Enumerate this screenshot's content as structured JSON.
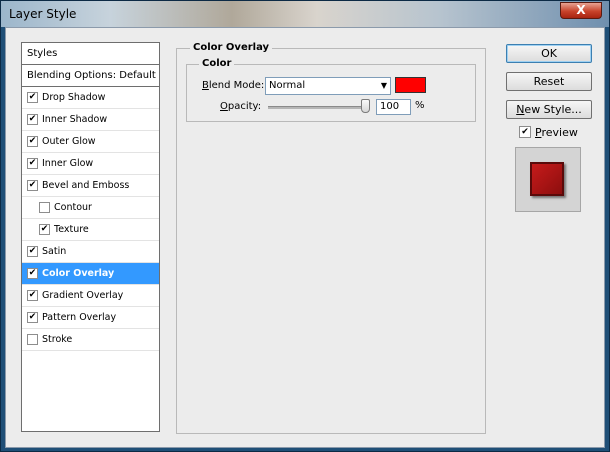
{
  "window": {
    "title": "Layer Style",
    "close_label": "X"
  },
  "styles_panel": {
    "header": "Styles",
    "blending_options": "Blending Options: Default",
    "items": [
      {
        "label": "Drop Shadow",
        "checked": true,
        "indent": false,
        "selected": false
      },
      {
        "label": "Inner Shadow",
        "checked": true,
        "indent": false,
        "selected": false
      },
      {
        "label": "Outer Glow",
        "checked": true,
        "indent": false,
        "selected": false
      },
      {
        "label": "Inner Glow",
        "checked": true,
        "indent": false,
        "selected": false
      },
      {
        "label": "Bevel and Emboss",
        "checked": true,
        "indent": false,
        "selected": false
      },
      {
        "label": "Contour",
        "checked": false,
        "indent": true,
        "selected": false
      },
      {
        "label": "Texture",
        "checked": true,
        "indent": true,
        "selected": false
      },
      {
        "label": "Satin",
        "checked": true,
        "indent": false,
        "selected": false
      },
      {
        "label": "Color Overlay",
        "checked": true,
        "indent": false,
        "selected": true
      },
      {
        "label": "Gradient Overlay",
        "checked": true,
        "indent": false,
        "selected": false
      },
      {
        "label": "Pattern Overlay",
        "checked": true,
        "indent": false,
        "selected": false
      },
      {
        "label": "Stroke",
        "checked": false,
        "indent": false,
        "selected": false
      }
    ]
  },
  "settings": {
    "group_title": "Color Overlay",
    "sub_group_title": "Color",
    "blend_mode_label_u": "B",
    "blend_mode_label_rest": "lend Mode:",
    "blend_mode_value": "Normal",
    "overlay_color": "#ff0000",
    "opacity_label_u": "O",
    "opacity_label_rest": "pacity:",
    "opacity_value": "100",
    "opacity_unit": "%"
  },
  "buttons": {
    "ok": "OK",
    "reset": "Reset",
    "new_style_u": "N",
    "new_style_rest": "ew Style...",
    "preview_u": "P",
    "preview_rest": "review",
    "preview_checked": true
  },
  "colors": {
    "selection": "#3399ff",
    "accent_red": "#ff0000"
  }
}
